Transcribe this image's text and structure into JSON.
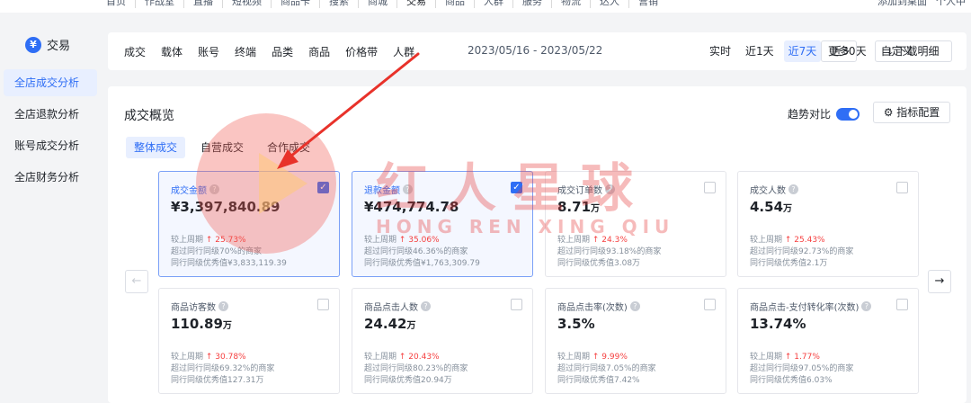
{
  "topnav": {
    "items": [
      "首页",
      "作战室",
      "直播",
      "短视频",
      "商品卡",
      "搜索",
      "商城",
      "交易",
      "商品",
      "人群",
      "服务",
      "物流",
      "达人",
      "营销"
    ],
    "right": [
      "添加到桌面",
      "个人中"
    ]
  },
  "sidebar": {
    "title": "交易",
    "items": [
      {
        "label": "全店成交分析",
        "active": true
      },
      {
        "label": "全店退款分析",
        "active": false
      },
      {
        "label": "账号成交分析",
        "active": false
      },
      {
        "label": "全店财务分析",
        "active": false
      }
    ]
  },
  "filter": {
    "tabs": [
      "成交",
      "载体",
      "账号",
      "终端",
      "品类",
      "商品",
      "价格带",
      "人群"
    ],
    "date_range": "2023/05/16 - 2023/05/22",
    "time_buttons": [
      {
        "label": "实时",
        "active": false
      },
      {
        "label": "近1天",
        "active": false
      },
      {
        "label": "近7天",
        "active": true
      },
      {
        "label": "近30天",
        "active": false
      },
      {
        "label": "自定义",
        "active": false
      }
    ],
    "more_label": "更多",
    "download_label": "下载明细"
  },
  "overview": {
    "title": "成交概览",
    "trend_label": "趋势对比",
    "config_label": "指标配置",
    "subtabs": [
      {
        "label": "整体成交",
        "active": true
      },
      {
        "label": "自营成交",
        "active": false
      },
      {
        "label": "合作成交",
        "active": false
      }
    ],
    "cards": [
      {
        "label": "成交金额",
        "value": "¥3,397,840.89",
        "unit": "",
        "checked": true,
        "compare_label": "较上周期",
        "change": "25.73%",
        "rank": "超过同行同级70%的商家",
        "benchmark": "同行同级优秀值¥3,833,119.39"
      },
      {
        "label": "退款金额",
        "value": "¥474,774.78",
        "unit": "",
        "checked": true,
        "compare_label": "较上周期",
        "change": "35.06%",
        "rank": "超过同行同级46.36%的商家",
        "benchmark": "同行同级优秀值¥1,763,309.79"
      },
      {
        "label": "成交订单数",
        "value": "8.71",
        "unit": "万",
        "checked": false,
        "compare_label": "较上周期",
        "change": "24.3%",
        "rank": "超过同行同级93.18%的商家",
        "benchmark": "同行同级优秀值3.08万"
      },
      {
        "label": "成交人数",
        "value": "4.54",
        "unit": "万",
        "checked": false,
        "compare_label": "较上周期",
        "change": "25.43%",
        "rank": "超过同行同级92.73%的商家",
        "benchmark": "同行同级优秀值2.1万"
      },
      {
        "label": "商品访客数",
        "value": "110.89",
        "unit": "万",
        "checked": false,
        "compare_label": "较上周期",
        "change": "30.78%",
        "rank": "超过同行同级69.32%的商家",
        "benchmark": "同行同级优秀值127.31万"
      },
      {
        "label": "商品点击人数",
        "value": "24.42",
        "unit": "万",
        "checked": false,
        "compare_label": "较上周期",
        "change": "20.43%",
        "rank": "超过同行同级80.23%的商家",
        "benchmark": "同行同级优秀值20.94万"
      },
      {
        "label": "商品点击率(次数)",
        "value": "3.5%",
        "unit": "",
        "checked": false,
        "compare_label": "较上周期",
        "change": "9.99%",
        "rank": "超过同行同级7.05%的商家",
        "benchmark": "同行同级优秀值7.42%"
      },
      {
        "label": "商品点击-支付转化率(次数)",
        "value": "13.74%",
        "unit": "",
        "checked": false,
        "compare_label": "较上周期",
        "change": "1.77%",
        "rank": "超过同行同级97.05%的商家",
        "benchmark": "同行同级优秀值6.03%"
      }
    ]
  },
  "watermark": {
    "title": "红人星球",
    "subtitle": "HONG REN XING QIU"
  },
  "colors": {
    "accent": "#2f6ef5",
    "up": "#f53f3f",
    "selected_bg": "#f4f7ff"
  }
}
